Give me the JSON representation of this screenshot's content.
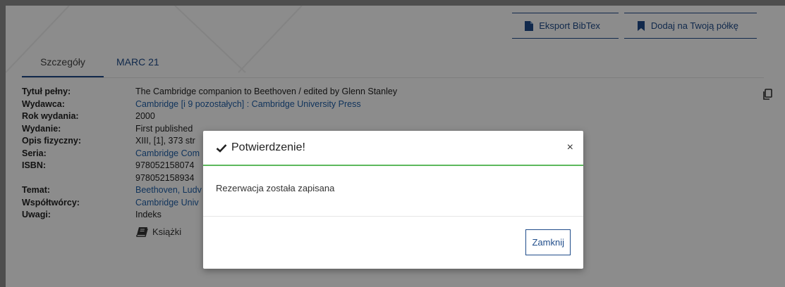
{
  "actions": {
    "export_label": "Eksport BibTex",
    "shelf_label": "Dodaj na Twoją półkę"
  },
  "tabs": [
    {
      "label": "Szczegóły"
    },
    {
      "label": "MARC 21"
    }
  ],
  "details": [
    {
      "label": "Tytuł pełny:",
      "value": "The Cambridge companion to Beethoven / edited by Glenn Stanley"
    },
    {
      "label": "Wydawca:",
      "value": "Cambridge [i 9 pozostałych] : Cambridge University Press"
    },
    {
      "label": "Rok wydania:",
      "value": "2000"
    },
    {
      "label": "Wydanie:",
      "value": "First published"
    },
    {
      "label": "Opis fizyczny:",
      "value": "XIII, [1], 373 str"
    },
    {
      "label": "Seria:",
      "value": "Cambridge Com"
    },
    {
      "label": "ISBN:",
      "value": "978052158074"
    },
    {
      "label": "",
      "value": "978052158934"
    },
    {
      "label": "Temat:",
      "value": "Beethoven, Ludv"
    },
    {
      "label": "Współtwórcy:",
      "value": "Cambridge Univ"
    },
    {
      "label": "Uwagi:",
      "value": "Indeks"
    }
  ],
  "format_label": "Książki",
  "modal": {
    "title": "Potwierdzenie!",
    "close_symbol": "×",
    "message": "Rezerwacja została zapisana",
    "button_label": "Zamknij"
  },
  "colors": {
    "accent": "#1f4c8a",
    "link": "#1f5fa8",
    "success": "#5cb85c"
  }
}
